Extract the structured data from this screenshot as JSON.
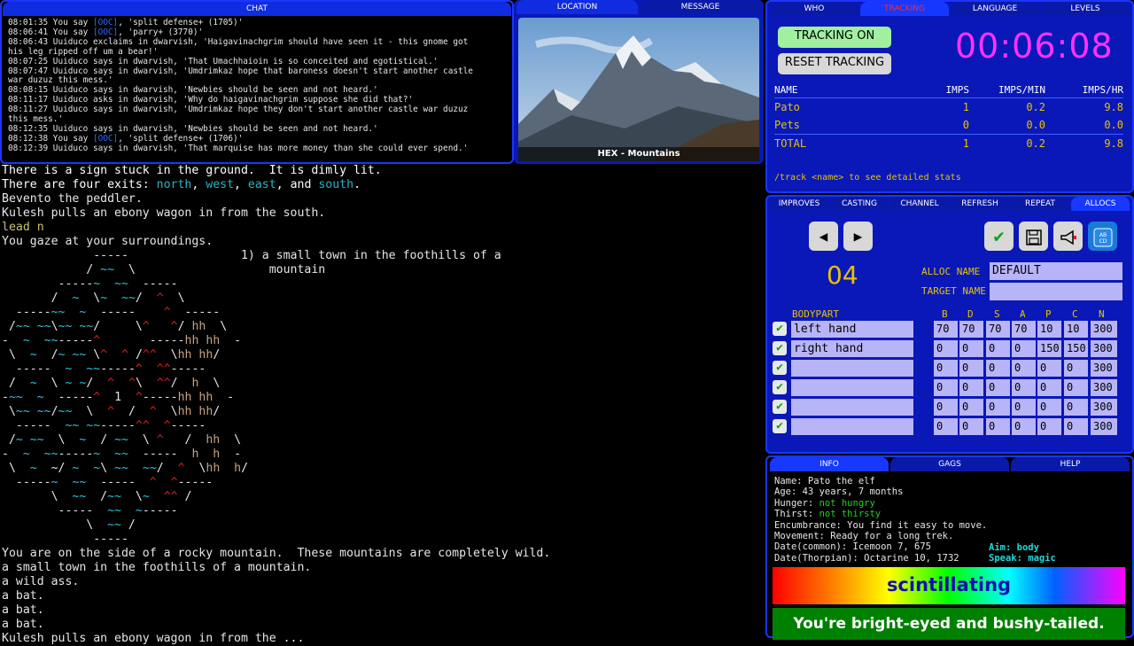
{
  "top_tabs": {
    "chat": "CHAT",
    "location": "LOCATION",
    "message": "MESSAGE"
  },
  "chat_lines": [
    {
      "t": "08:01:35 You say ",
      "ooc": "[OOC]",
      "rest": ", 'split defense+ (1705)'"
    },
    {
      "t": "08:06:41 You say ",
      "ooc": "[OOC]",
      "rest": ", 'parry+ (3770)'"
    },
    {
      "t": "08:06:43 Uuiduco exclaims in dwarvish, 'Haigavinachgrim should have seen it - this gnome got",
      "ooc": "",
      "rest": ""
    },
    {
      "t": "his leg ripped off um a bear!'",
      "ooc": "",
      "rest": ""
    },
    {
      "t": "08:07:25 Uuiduco says in dwarvish, 'That Umachhaioin is so conceited and egotistical.'",
      "ooc": "",
      "rest": ""
    },
    {
      "t": "08:07:47 Uuiduco says in dwarvish, 'Umdrimkaz hope that baroness doesn't start another castle",
      "ooc": "",
      "rest": ""
    },
    {
      "t": "war duzuz this mess.'",
      "ooc": "",
      "rest": ""
    },
    {
      "t": "08:08:15 Uuiduco says in dwarvish, 'Newbies should be seen and not heard.'",
      "ooc": "",
      "rest": ""
    },
    {
      "t": "08:11:17 Uuiduco asks in dwarvish, 'Why do haigavinachgrim suppose she did that?'",
      "ooc": "",
      "rest": ""
    },
    {
      "t": "08:11:27 Uuiduco says in dwarvish, 'Umdrimkaz hope they don't start another castle war duzuz",
      "ooc": "",
      "rest": ""
    },
    {
      "t": "this mess.'",
      "ooc": "",
      "rest": ""
    },
    {
      "t": "08:12:35 Uuiduco says in dwarvish, 'Newbies should be seen and not heard.'",
      "ooc": "",
      "rest": ""
    },
    {
      "t": "08:12:38 You say ",
      "ooc": "[OOC]",
      "rest": ", 'split defense+ (1706)'"
    },
    {
      "t": "08:12:39 Uuiduco says in dwarvish, 'That marquise has more money than she could ever spend.'",
      "ooc": "",
      "rest": ""
    }
  ],
  "location": {
    "caption": "HEX - Mountains"
  },
  "main": {
    "line1": "There is a sign stuck in the ground.  It is dimly lit.",
    "exits_prefix": "There are four exits: ",
    "exit1": "north",
    "exit2": "west",
    "exit3": "east",
    "exit_and": "and",
    "exit4": "south",
    "line3": "Bevento the peddler.",
    "line4": "Kulesh pulls an ebony wagon in from the south.",
    "command": "lead n",
    "line6": "You gaze at your surroundings.",
    "legend1": "1) a small town in the foothills of a",
    "legend2": "   mountain",
    "desc1": "You are on the side of a rocky mountain.  These mountains are completely wild.",
    "desc2": "a small town in the foothills of a mountain.",
    "desc3": "a wild ass.",
    "desc4": "a bat.",
    "desc5": "a bat.",
    "desc6": "a bat.",
    "desc7": "Kulesh pulls an ebony wagon in from the ..."
  },
  "right_tabs": {
    "who": "WHO",
    "tracking": "TRACKING",
    "language": "LANGUAGE",
    "levels": "LEVELS"
  },
  "tracking": {
    "on_label": "TRACKING ON",
    "reset_label": "RESET TRACKING",
    "timer": "00:06:08",
    "headers": [
      "NAME",
      "IMPS",
      "IMPS/MIN",
      "IMPS/HR"
    ],
    "rows": [
      {
        "name": "Pato",
        "imps": "1",
        "min": "0.2",
        "hr": "9.8"
      },
      {
        "name": "Pets",
        "imps": "0",
        "min": "0.0",
        "hr": "0.0"
      }
    ],
    "total": {
      "name": "TOTAL",
      "imps": "1",
      "min": "0.2",
      "hr": "9.8"
    },
    "hint": "/track <name> to see detailed stats"
  },
  "mid_tabs": {
    "improves": "IMPROVES",
    "casting": "CASTING",
    "channel": "CHANNEL",
    "refresh": "REFRESH",
    "repeat": "REPEAT",
    "allocs": "ALLOCS"
  },
  "allocs": {
    "number": "04",
    "alloc_name_label": "ALLOC NAME",
    "alloc_name": "DEFAULT",
    "target_name_label": "TARGET NAME",
    "target_name": "",
    "bodypart_label": "BODYPART",
    "cols": [
      "B",
      "D",
      "S",
      "A",
      "P",
      "C",
      "N"
    ],
    "rows": [
      {
        "part": "left hand",
        "vals": [
          "70",
          "70",
          "70",
          "70",
          "10",
          "10",
          "300"
        ]
      },
      {
        "part": "right hand",
        "vals": [
          "0",
          "0",
          "0",
          "0",
          "150",
          "150",
          "300"
        ]
      },
      {
        "part": "",
        "vals": [
          "0",
          "0",
          "0",
          "0",
          "0",
          "0",
          "300"
        ]
      },
      {
        "part": "",
        "vals": [
          "0",
          "0",
          "0",
          "0",
          "0",
          "0",
          "300"
        ]
      },
      {
        "part": "",
        "vals": [
          "0",
          "0",
          "0",
          "0",
          "0",
          "0",
          "300"
        ]
      },
      {
        "part": "",
        "vals": [
          "0",
          "0",
          "0",
          "0",
          "0",
          "0",
          "300"
        ]
      }
    ]
  },
  "bottom_tabs": {
    "info": "INFO",
    "gags": "GAGS",
    "help": "HELP"
  },
  "info": {
    "name": "Name: Pato the elf",
    "age": "Age: 43 years, 7 months",
    "hunger_label": "Hunger: ",
    "hunger": "not hungry",
    "thirst_label": "Thirst: ",
    "thirst": "not thirsty",
    "encumbrance": "Encumbrance: You find it easy to move.",
    "movement": "Movement: Ready for a long trek.",
    "date_common": "Date(common): Icemoon 7, 675",
    "date_thorpian": "Date(Thorpian): Octarine 10, 1732",
    "aim_label": "Aim:",
    "aim": "body",
    "speak_label": "Speak:",
    "speak": "magic",
    "mood": "scintillating",
    "status": "You're bright-eyed and bushy-tailed."
  }
}
